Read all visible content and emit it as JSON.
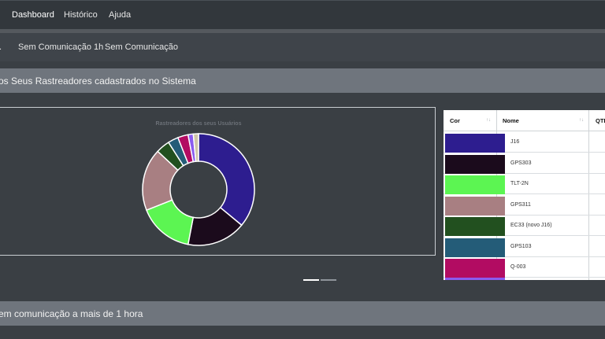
{
  "topnav": {
    "items": [
      {
        "label": "Dashboard",
        "active": true
      },
      {
        "label": "Histórico",
        "active": false
      },
      {
        "label": "Ajuda",
        "active": false
      }
    ]
  },
  "subnav": {
    "items": [
      {
        "label": "."
      },
      {
        "label": "Sem Comunicação 1h"
      },
      {
        "label": "Sem Comunicação"
      }
    ]
  },
  "section1": {
    "title": "os Seus Rastreadores cadastrados no Sistema"
  },
  "section2": {
    "title": "em comunicação a mais de 1 hora"
  },
  "chart_data": {
    "type": "pie",
    "donut": true,
    "title": "Rastreadores dos seus Usuários",
    "legend": "none",
    "series": [
      {
        "name": "J16",
        "value": 36,
        "color": "#2d1d8f"
      },
      {
        "name": "GPS303",
        "value": 17,
        "color": "#1b0b1c"
      },
      {
        "name": "TLT-2N",
        "value": 16,
        "color": "#5cf552"
      },
      {
        "name": "GPS311",
        "value": 18,
        "color": "#a87f82"
      },
      {
        "name": "EC33 (novo J16)",
        "value": 4,
        "color": "#22501f"
      },
      {
        "name": "GPS103",
        "value": 3,
        "color": "#245c78"
      },
      {
        "name": "Q-003",
        "value": 3,
        "color": "#b20c62"
      },
      {
        "name": "",
        "value": 1.5,
        "color": "#8a5cf0"
      },
      {
        "name": "",
        "value": 1.5,
        "color": "#cfc6a8"
      }
    ]
  },
  "table": {
    "headers": {
      "cor": "Cor",
      "nome": "Nome",
      "qtd": "QTD"
    },
    "sort_icon": "↑↓",
    "rows": [
      {
        "nome": "J16",
        "color": "#2d1d8f"
      },
      {
        "nome": "GPS303",
        "color": "#1b0b1c"
      },
      {
        "nome": "TLT-2N",
        "color": "#5cf552"
      },
      {
        "nome": "GPS311",
        "color": "#a87f82"
      },
      {
        "nome": "EC33 (novo J16)",
        "color": "#22501f"
      },
      {
        "nome": "GPS103",
        "color": "#245c78"
      },
      {
        "nome": "Q-003",
        "color": "#b20c62"
      }
    ]
  },
  "pager": {
    "active_color": "#ffffff",
    "inactive_color": "#8e949a"
  }
}
